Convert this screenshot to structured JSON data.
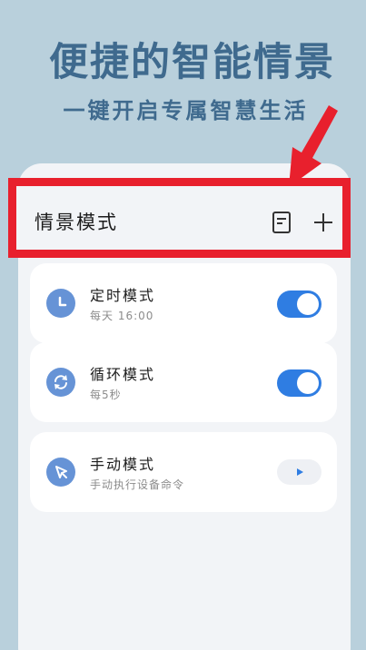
{
  "promo": {
    "headline": "便捷的智能情景",
    "subline": "一键开启专属智慧生活"
  },
  "header": {
    "title": "情景模式",
    "doc_icon": "document-icon",
    "add_icon": "plus-icon"
  },
  "modes": [
    {
      "name": "定时模式",
      "detail": "每天 16:00",
      "icon": "clock-icon",
      "control": "toggle",
      "enabled": true
    },
    {
      "name": "循环模式",
      "detail": "每5秒",
      "icon": "refresh-icon",
      "control": "toggle",
      "enabled": true
    },
    {
      "name": "手动模式",
      "detail": "手动执行设备命令",
      "icon": "cursor-click-icon",
      "control": "play",
      "enabled": false
    }
  ],
  "colors": {
    "background": "#b9d0dc",
    "headline": "#3f6a8e",
    "highlight": "#e8202d",
    "accent": "#2f7de2",
    "icon_circle": "#6693d6"
  }
}
